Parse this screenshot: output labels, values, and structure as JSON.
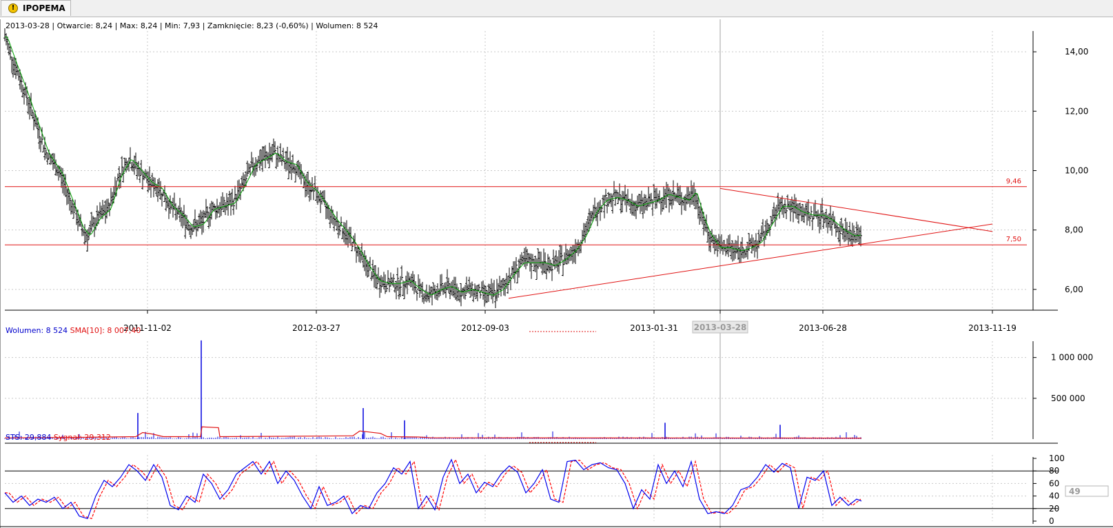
{
  "window": {
    "tab_title": "IPOPEMA",
    "tab_icon": "warning-icon"
  },
  "info_bar": {
    "text": "2013-03-28 | Otwarcie: 8,24 | Max: 8,24 | Min: 7,93 | Zamknięcie: 8,23 (-0,60%)   | Wolumen: 8 524"
  },
  "volume_panel": {
    "label_vol": "Wolumen: 8 524",
    "label_sma": "SMA[10]: 8 007,40"
  },
  "sts_panel": {
    "label_sts": "STS: 29,884",
    "label_signal": "Sygnał: 29,312",
    "current_value_box": "49"
  },
  "colors": {
    "price_bars": "#000000",
    "moving_average": "#00a000",
    "levels": "#e01010",
    "volume": "#0000dd",
    "sts": "#0000ee",
    "signal": "#ff0000",
    "grid": "#c8c8c8"
  },
  "chart_data": [
    {
      "type": "ohlc",
      "panel": "price",
      "x_ticks": [
        "2011-11-02",
        "2012-03-27",
        "2012-09-03",
        "2013-01-31",
        "2013-03-28",
        "2013-06-28",
        "2013-11-19"
      ],
      "highlighted_x_tick": "2013-03-28",
      "y_ticks": [
        "6,00",
        "8,00",
        "10,00",
        "12,00",
        "14,00"
      ],
      "ylim": [
        5.3,
        14.7
      ],
      "horizontal_levels": [
        {
          "value": 9.46,
          "label": "9,46"
        },
        {
          "value": 7.5,
          "label": "7,50"
        }
      ],
      "trendlines": [
        {
          "from": [
            "2013-03-28",
            9.4
          ],
          "to": [
            "2013-11-19",
            7.95
          ]
        },
        {
          "from": [
            "2012-09-15",
            5.7
          ],
          "to": [
            "2013-11-19",
            8.2
          ]
        }
      ],
      "close_path": [
        [
          0,
          14.5
        ],
        [
          12,
          13.7
        ],
        [
          30,
          12.6
        ],
        [
          45,
          11.6
        ],
        [
          60,
          10.6
        ],
        [
          80,
          9.9
        ],
        [
          95,
          9.0
        ],
        [
          110,
          8.1
        ],
        [
          120,
          7.8
        ],
        [
          135,
          8.4
        ],
        [
          150,
          8.7
        ],
        [
          165,
          9.8
        ],
        [
          180,
          10.4
        ],
        [
          195,
          10.0
        ],
        [
          210,
          9.6
        ],
        [
          225,
          9.4
        ],
        [
          240,
          8.8
        ],
        [
          255,
          8.5
        ],
        [
          270,
          8.1
        ],
        [
          285,
          8.2
        ],
        [
          300,
          8.7
        ],
        [
          315,
          8.8
        ],
        [
          330,
          8.9
        ],
        [
          345,
          9.5
        ],
        [
          360,
          10.2
        ],
        [
          375,
          10.4
        ],
        [
          390,
          10.6
        ],
        [
          405,
          10.3
        ],
        [
          420,
          10.2
        ],
        [
          435,
          9.6
        ],
        [
          450,
          9.3
        ],
        [
          465,
          8.8
        ],
        [
          480,
          8.3
        ],
        [
          495,
          7.9
        ],
        [
          510,
          7.4
        ],
        [
          525,
          6.8
        ],
        [
          540,
          6.3
        ],
        [
          555,
          6.2
        ],
        [
          570,
          6.2
        ],
        [
          585,
          6.3
        ],
        [
          600,
          6.0
        ],
        [
          615,
          5.8
        ],
        [
          630,
          6.0
        ],
        [
          645,
          6.1
        ],
        [
          660,
          5.9
        ],
        [
          675,
          6.0
        ],
        [
          690,
          5.9
        ],
        [
          705,
          5.8
        ],
        [
          720,
          6.0
        ],
        [
          735,
          6.5
        ],
        [
          750,
          6.9
        ],
        [
          765,
          6.9
        ],
        [
          780,
          6.9
        ],
        [
          795,
          6.8
        ],
        [
          810,
          7.0
        ],
        [
          825,
          7.3
        ],
        [
          840,
          7.8
        ],
        [
          855,
          8.6
        ],
        [
          870,
          9.0
        ],
        [
          885,
          9.1
        ],
        [
          900,
          9.0
        ],
        [
          915,
          8.8
        ],
        [
          930,
          8.9
        ],
        [
          945,
          9.0
        ],
        [
          960,
          9.2
        ],
        [
          975,
          9.1
        ],
        [
          990,
          9.0
        ],
        [
          1000,
          9.3
        ],
        [
          1010,
          8.5
        ],
        [
          1020,
          7.9
        ],
        [
          1035,
          7.4
        ],
        [
          1050,
          7.4
        ],
        [
          1065,
          7.3
        ],
        [
          1080,
          7.4
        ],
        [
          1095,
          7.6
        ],
        [
          1110,
          8.2
        ],
        [
          1125,
          8.8
        ],
        [
          1140,
          8.8
        ],
        [
          1155,
          8.6
        ],
        [
          1170,
          8.5
        ],
        [
          1185,
          8.5
        ],
        [
          1200,
          8.3
        ],
        [
          1215,
          8.0
        ],
        [
          1230,
          7.8
        ],
        [
          1243,
          7.85
        ]
      ]
    },
    {
      "type": "bar",
      "panel": "volume",
      "series": [
        {
          "name": "Wolumen",
          "color": "#0000dd"
        },
        {
          "name": "SMA[10]",
          "color": "#e01010"
        }
      ],
      "y_ticks": [
        "500 000",
        "1 000 000"
      ],
      "ylim": [
        0,
        1200000
      ],
      "spikes": [
        {
          "x": 193,
          "value": 320000
        },
        {
          "x": 285,
          "value": 1210000
        },
        {
          "x": 520,
          "value": 380000
        },
        {
          "x": 580,
          "value": 230000
        },
        {
          "x": 958,
          "value": 200000
        },
        {
          "x": 1125,
          "value": 175000
        }
      ],
      "sma_path": [
        [
          0,
          15000
        ],
        [
          100,
          20000
        ],
        [
          190,
          30000
        ],
        [
          200,
          80000
        ],
        [
          215,
          60000
        ],
        [
          230,
          30000
        ],
        [
          284,
          30000
        ],
        [
          286,
          150000
        ],
        [
          310,
          140000
        ],
        [
          312,
          30000
        ],
        [
          505,
          40000
        ],
        [
          515,
          100000
        ],
        [
          545,
          70000
        ],
        [
          555,
          30000
        ],
        [
          600,
          25000
        ],
        [
          620,
          15000
        ],
        [
          1243,
          12000
        ]
      ]
    },
    {
      "type": "line",
      "panel": "stochastic",
      "series": [
        {
          "name": "STS",
          "color": "#0000ee"
        },
        {
          "name": "Sygnał",
          "color": "#ff0000"
        }
      ],
      "y_ticks": [
        "0",
        "20",
        "40",
        "60",
        "80",
        "100"
      ],
      "ylim": [
        0,
        100
      ],
      "levels": [
        20,
        80
      ],
      "sts_path": [
        [
          0,
          45
        ],
        [
          12,
          30
        ],
        [
          24,
          40
        ],
        [
          36,
          25
        ],
        [
          48,
          35
        ],
        [
          60,
          30
        ],
        [
          72,
          38
        ],
        [
          84,
          20
        ],
        [
          96,
          30
        ],
        [
          108,
          8
        ],
        [
          120,
          4
        ],
        [
          132,
          40
        ],
        [
          144,
          65
        ],
        [
          156,
          55
        ],
        [
          168,
          70
        ],
        [
          180,
          90
        ],
        [
          192,
          80
        ],
        [
          204,
          65
        ],
        [
          216,
          90
        ],
        [
          228,
          70
        ],
        [
          240,
          25
        ],
        [
          252,
          18
        ],
        [
          264,
          40
        ],
        [
          276,
          30
        ],
        [
          288,
          75
        ],
        [
          300,
          60
        ],
        [
          312,
          35
        ],
        [
          324,
          50
        ],
        [
          336,
          75
        ],
        [
          348,
          85
        ],
        [
          360,
          95
        ],
        [
          372,
          75
        ],
        [
          384,
          95
        ],
        [
          396,
          60
        ],
        [
          408,
          80
        ],
        [
          420,
          65
        ],
        [
          432,
          40
        ],
        [
          444,
          20
        ],
        [
          456,
          55
        ],
        [
          468,
          25
        ],
        [
          480,
          30
        ],
        [
          492,
          40
        ],
        [
          504,
          12
        ],
        [
          516,
          25
        ],
        [
          528,
          20
        ],
        [
          540,
          45
        ],
        [
          552,
          60
        ],
        [
          564,
          85
        ],
        [
          576,
          75
        ],
        [
          588,
          95
        ],
        [
          600,
          20
        ],
        [
          612,
          40
        ],
        [
          624,
          18
        ],
        [
          636,
          70
        ],
        [
          648,
          98
        ],
        [
          660,
          60
        ],
        [
          672,
          75
        ],
        [
          684,
          45
        ],
        [
          696,
          62
        ],
        [
          708,
          55
        ],
        [
          720,
          75
        ],
        [
          732,
          88
        ],
        [
          744,
          78
        ],
        [
          756,
          45
        ],
        [
          768,
          60
        ],
        [
          780,
          82
        ],
        [
          792,
          35
        ],
        [
          804,
          30
        ],
        [
          816,
          95
        ],
        [
          828,
          97
        ],
        [
          840,
          82
        ],
        [
          852,
          90
        ],
        [
          864,
          93
        ],
        [
          876,
          85
        ],
        [
          888,
          82
        ],
        [
          900,
          60
        ],
        [
          912,
          20
        ],
        [
          924,
          50
        ],
        [
          936,
          35
        ],
        [
          948,
          90
        ],
        [
          960,
          60
        ],
        [
          972,
          80
        ],
        [
          984,
          55
        ],
        [
          996,
          95
        ],
        [
          1008,
          35
        ],
        [
          1020,
          12
        ],
        [
          1032,
          15
        ],
        [
          1044,
          12
        ],
        [
          1056,
          25
        ],
        [
          1068,
          50
        ],
        [
          1080,
          55
        ],
        [
          1092,
          70
        ],
        [
          1104,
          90
        ],
        [
          1116,
          78
        ],
        [
          1128,
          92
        ],
        [
          1140,
          85
        ],
        [
          1152,
          20
        ],
        [
          1164,
          70
        ],
        [
          1176,
          65
        ],
        [
          1188,
          80
        ],
        [
          1200,
          25
        ],
        [
          1212,
          38
        ],
        [
          1224,
          25
        ],
        [
          1236,
          35
        ],
        [
          1243,
          32
        ]
      ]
    }
  ]
}
